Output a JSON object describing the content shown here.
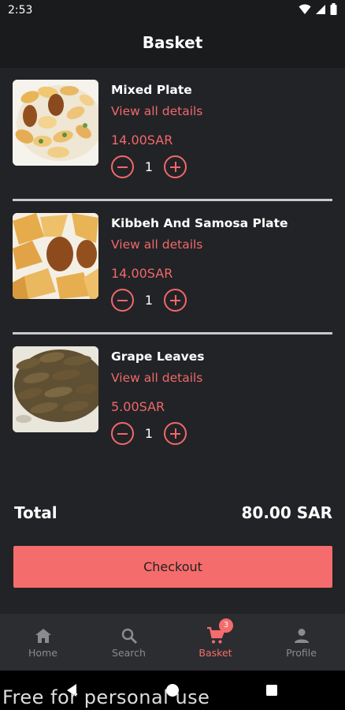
{
  "status_bar": {
    "time": "2:53",
    "icons": [
      "wifi-icon",
      "signal-icon",
      "battery-icon"
    ]
  },
  "header": {
    "title": "Basket"
  },
  "colors": {
    "accent": "#f56c6c",
    "background": "#222326",
    "bar": "#1a1b1d",
    "nav": "#2c2d30"
  },
  "items": [
    {
      "name": "Mixed Plate",
      "details_link": "View all details",
      "price": "14.00SAR",
      "quantity": "1",
      "image": "mixed-plate-photo"
    },
    {
      "name": "Kibbeh And Samosa Plate",
      "details_link": "View all details",
      "price": "14.00SAR",
      "quantity": "1",
      "image": "kibbeh-samosa-photo"
    },
    {
      "name": "Grape Leaves",
      "details_link": "View all details",
      "price": "5.00SAR",
      "quantity": "1",
      "image": "grape-leaves-photo"
    }
  ],
  "total": {
    "label": "Total",
    "value": "80.00 SAR"
  },
  "checkout_label": "Checkout",
  "bottom_nav": [
    {
      "label": "Home",
      "icon": "home-icon",
      "active": false
    },
    {
      "label": "Search",
      "icon": "search-icon",
      "active": false
    },
    {
      "label": "Basket",
      "icon": "cart-icon",
      "active": true,
      "badge": "3"
    },
    {
      "label": "Profile",
      "icon": "person-icon",
      "active": false
    }
  ],
  "watermark": "Free for personal use"
}
